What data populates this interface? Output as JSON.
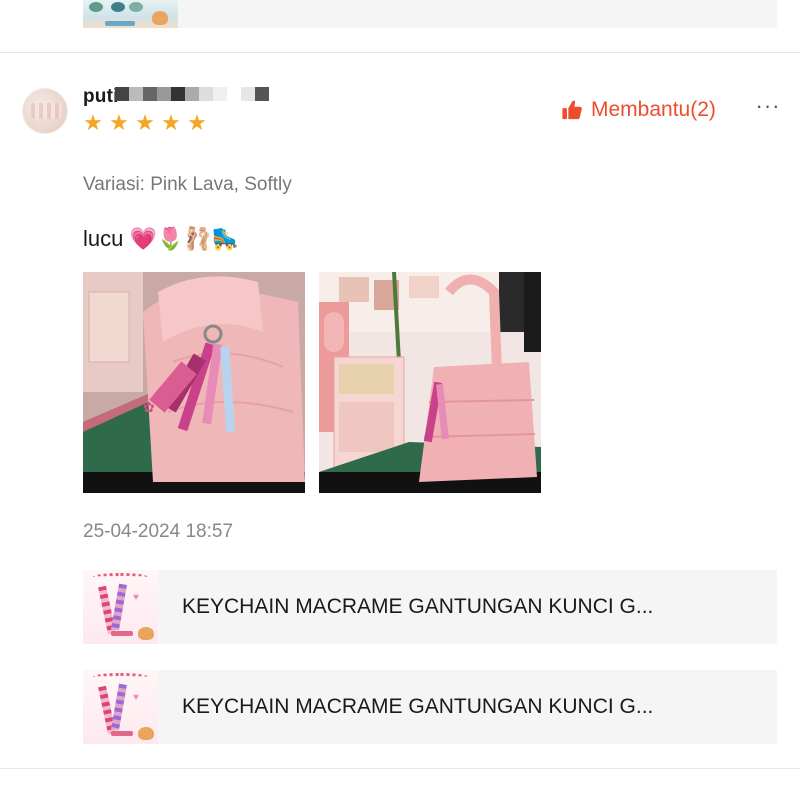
{
  "previous_review": {
    "product_thumb_icon": "product-thumbnail-icon"
  },
  "review": {
    "username": "puti",
    "username_mask_colors": [
      "#444444",
      "#bbbbbb",
      "#666666",
      "#999999",
      "#333333",
      "#aaaaaa",
      "#dddddd",
      "#f0f0f0",
      "#ffffff",
      "#e6e6e6",
      "#555555"
    ],
    "rating": 5,
    "rating_max": 5,
    "star_color": "#f6a623",
    "helpful_label": "Membantu(2)",
    "accent_color": "#ee4d2d",
    "more_label": "···",
    "variation": "Variasi: Pink Lava, Softly",
    "comment": "lucu 💗🌷🩰🛼",
    "photos": [
      {
        "name": "review-photo-1",
        "desc_icon": "pink-bag-with-keychain-photo"
      },
      {
        "name": "review-photo-2",
        "desc_icon": "pink-bag-in-room-photo"
      }
    ],
    "timestamp": "25-04-2024 18:57"
  },
  "products": [
    {
      "title": "KEYCHAIN MACRAME GANTUNGAN KUNCI G..."
    },
    {
      "title": "KEYCHAIN MACRAME GANTUNGAN KUNCI G..."
    }
  ]
}
